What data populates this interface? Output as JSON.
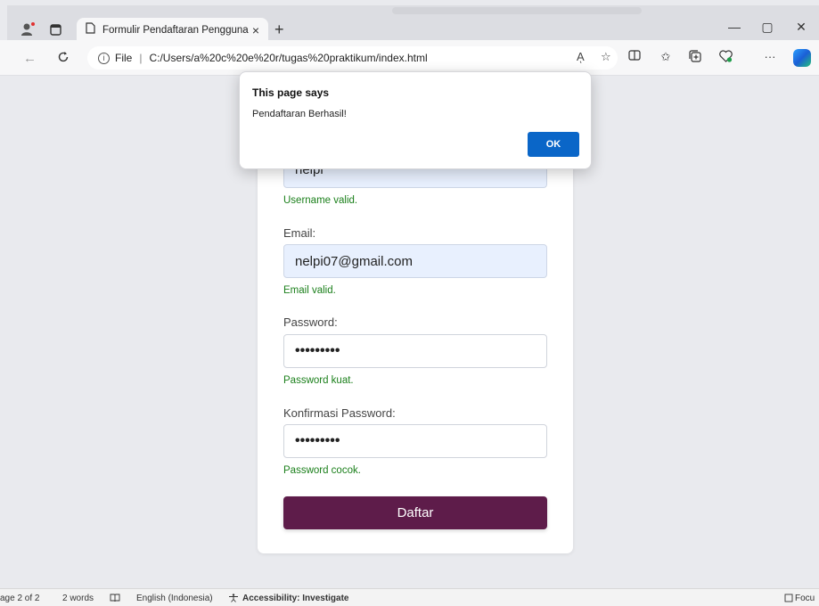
{
  "browser": {
    "tab_title": "Formulir Pendaftaran Pengguna",
    "tab_close": "×",
    "new_tab": "+",
    "address_scheme": "File",
    "address_path": "C:/Users/a%20c%20e%20r/tugas%20praktikum/index.html",
    "read_aloud": "Aͅ",
    "window": {
      "minimize": "—",
      "maximize": "▢",
      "close": "✕"
    }
  },
  "form": {
    "username_value": "nelpi",
    "username_msg": "Username valid.",
    "email_label": "Email:",
    "email_value": "nelpi07@gmail.com",
    "email_msg": "Email valid.",
    "password_label": "Password:",
    "password_value": "•••••••••",
    "password_msg": "Password kuat.",
    "confirm_label": "Konfirmasi Password:",
    "confirm_value": "•••••••••",
    "confirm_msg": "Password cocok.",
    "submit_label": "Daftar",
    "colors": {
      "submit_bg": "#5e1c4a",
      "valid_text": "#1a7f1a",
      "autofill_bg": "#e8f0fe"
    }
  },
  "dialog": {
    "title": "This page says",
    "message": "Pendaftaran Berhasil!",
    "ok_label": "OK",
    "ok_color": "#0a66c8"
  },
  "statusbar": {
    "page": "age 2 of 2",
    "words": "2 words",
    "language": "English (Indonesia)",
    "accessibility": "Accessibility: Investigate",
    "focus": "Focu"
  },
  "icons": [
    "profile-icon",
    "tab-actions-icon",
    "page-icon",
    "back-icon",
    "reload-icon",
    "info-icon",
    "read-aloud-icon",
    "favorite-icon",
    "split-screen-icon",
    "favorites-icon",
    "collections-icon",
    "performance-icon",
    "more-icon",
    "copilot-icon"
  ]
}
